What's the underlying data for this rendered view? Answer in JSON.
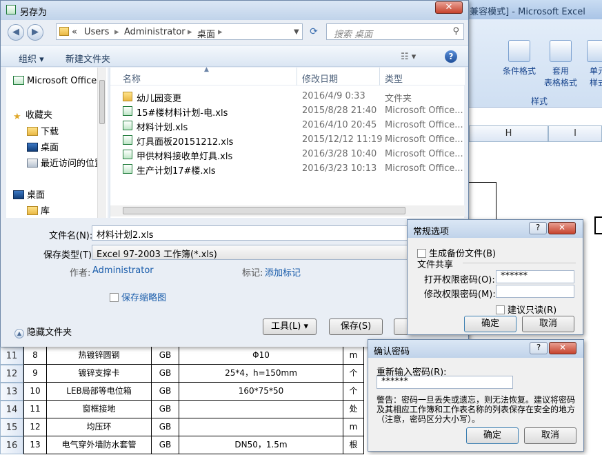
{
  "excel": {
    "title": "[兼容模式] - Microsoft Excel",
    "ribbon": {
      "cond_format": "条件格式",
      "table_format_1": "套用",
      "table_format_2": "表格格式",
      "cell_style_1": "单元",
      "cell_style_2": "样式",
      "group_label": "样式"
    },
    "cols": [
      "H",
      "I"
    ],
    "rows": [
      {
        "num": "11",
        "idx": "8",
        "name": "热镀锌圆钢",
        "std": "GB",
        "spec": "Φ10",
        "unit": "m"
      },
      {
        "num": "12",
        "idx": "9",
        "name": "镀锌支撑卡",
        "std": "GB",
        "spec": "25*4，h=150mm",
        "unit": "个"
      },
      {
        "num": "13",
        "idx": "10",
        "name": "LEB局部等电位箱",
        "std": "GB",
        "spec": "160*75*50",
        "unit": "个"
      },
      {
        "num": "14",
        "idx": "11",
        "name": "窗框接地",
        "std": "GB",
        "spec": "",
        "unit": "处"
      },
      {
        "num": "15",
        "idx": "12",
        "name": "均压环",
        "std": "GB",
        "spec": "",
        "unit": "m"
      },
      {
        "num": "16",
        "idx": "13",
        "name": "电气穿外墙防水套管",
        "std": "GB",
        "spec": "DN50，1.5m",
        "unit": "根"
      }
    ]
  },
  "save": {
    "title": "另存为",
    "close": "✕",
    "back": "◀",
    "forward": "▶",
    "crumbs": [
      "Users",
      "Administrator",
      "桌面"
    ],
    "search_placeholder": "搜索 桌面",
    "organize": "组织 ▾",
    "new_folder": "新建文件夹",
    "nav": [
      "Microsoft Office",
      "收藏夹",
      "下载",
      "桌面",
      "最近访问的位置",
      "桌面",
      "库"
    ],
    "headers": {
      "name": "名称",
      "date": "修改日期",
      "type": "类型"
    },
    "files": [
      {
        "name": "幼儿园变更",
        "date": "2016/4/9 0:33",
        "type": "文件夹",
        "folder": true
      },
      {
        "name": "15#楼材料计划-电.xls",
        "date": "2015/8/28 21:40",
        "type": "Microsoft Office..."
      },
      {
        "name": "材料计划.xls",
        "date": "2016/4/10 20:45",
        "type": "Microsoft Office..."
      },
      {
        "name": "灯具面板20151212.xls",
        "date": "2015/12/12 11:19",
        "type": "Microsoft Office..."
      },
      {
        "name": "甲供材料接收单灯具.xls",
        "date": "2016/3/28 10:40",
        "type": "Microsoft Office..."
      },
      {
        "name": "生产计划17#楼.xls",
        "date": "2016/3/23 10:13",
        "type": "Microsoft Office..."
      }
    ],
    "filename_label": "文件名(N):",
    "filename_value": "材料计划2.xls",
    "filetype_label": "保存类型(T):",
    "filetype_value": "Excel 97-2003 工作簿(*.xls)",
    "author_label": "作者:",
    "author_value": "Administrator",
    "tags_label": "标记:",
    "tags_value": "添加标记",
    "thumbnail_label": "保存缩略图",
    "hide_folders": "隐藏文件夹",
    "tools": "工具(L)",
    "save_btn": "保存(S)"
  },
  "options": {
    "title": "常规选项",
    "help": "?",
    "close": "✕",
    "backup": "生成备份文件(B)",
    "share_group": "文件共享",
    "open_pwd_label": "打开权限密码(O):",
    "open_pwd_value": "******",
    "modify_pwd_label": "修改权限密码(M):",
    "modify_pwd_value": "",
    "readonly": "建议只读(R)",
    "ok": "确定",
    "cancel": "取消"
  },
  "confirm": {
    "title": "确认密码",
    "help": "?",
    "close": "✕",
    "reenter_label": "重新输入密码(R):",
    "reenter_value": "******",
    "warning": "警告：密码一旦丢失或遗忘，则无法恢复。建议将密码及其相应工作簿和工作表名称的列表保存在安全的地方（注意，密码区分大小写）。",
    "ok": "确定",
    "cancel": "取消"
  }
}
